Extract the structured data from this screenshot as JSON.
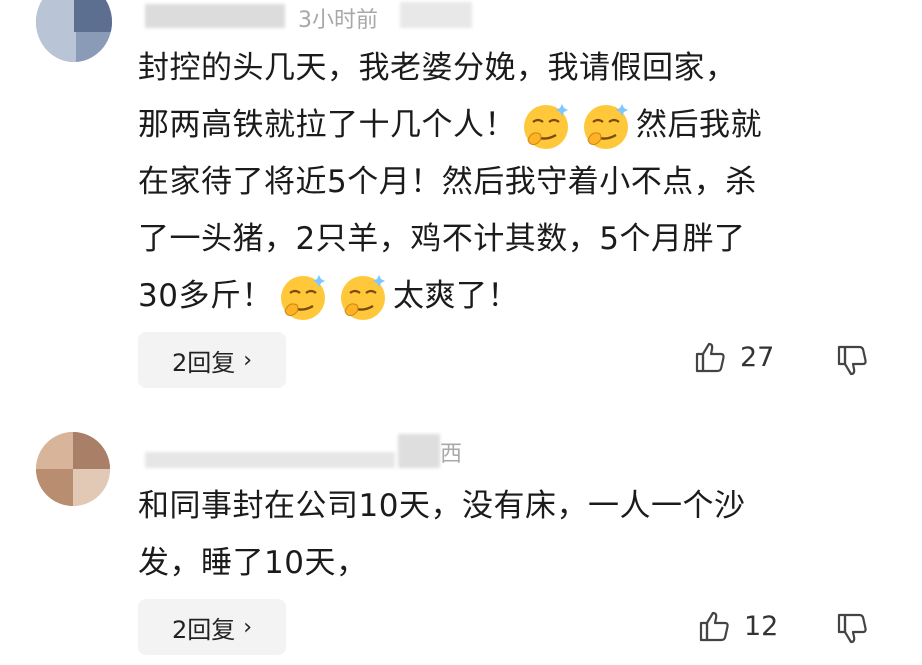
{
  "comments": [
    {
      "time": "3小时前",
      "lines": [
        [
          "封控的头几天，我老婆分娩，我请假回家，"
        ],
        [
          "那两高铁就拉了十几个人！",
          "emoji",
          "emoji",
          "然后我就"
        ],
        [
          "在家待了将近5个月！然后我守着小不点，杀"
        ],
        [
          "了一头猪，2只羊，鸡不计其数，5个月胖了"
        ],
        [
          "30多斤！",
          "emoji",
          "emoji",
          "太爽了！"
        ]
      ],
      "replies_label": "2回复",
      "likes": "27"
    },
    {
      "location": "西",
      "lines": [
        [
          "和同事封在公司10天，没有床，一人一个沙"
        ],
        [
          "发，睡了10天，"
        ]
      ],
      "replies_label": "2回复",
      "likes": "12"
    }
  ],
  "icons": {
    "emoji": "smirk-face-icon",
    "like": "thumbs-up-icon",
    "dislike": "thumbs-down-icon",
    "chevron": "chevron-right-icon"
  },
  "chevron": "›"
}
